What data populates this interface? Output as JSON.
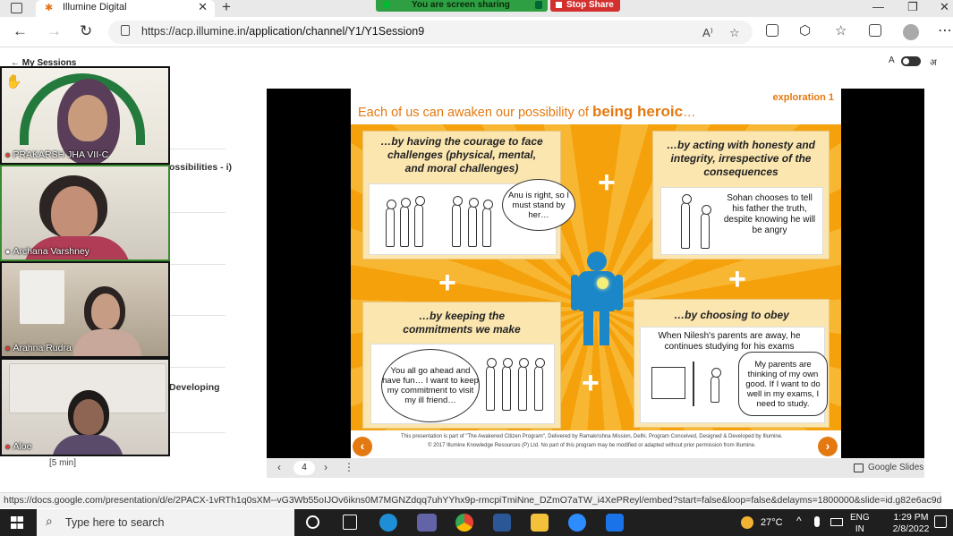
{
  "browser": {
    "tab_title": "Illumine Digital",
    "new_tab": "+",
    "tab_close": "✕",
    "url_host": "https://acp.illumine.in",
    "url_path": "/application/channel/Y1/Y1Session9",
    "status_url": "https://docs.google.com/presentation/d/e/2PACX-1vRTh1q0sXM--vG3Wb55oIJOv6ikns0M7MGNZdqq7uhYYhx9p-rmcpiTmiNne_DZmO7aTW_i4XePReyl/embed?start=false&loop=false&delayms=1800000&slide=id.g82e6ac9d00_2_2...",
    "window_controls": [
      "—",
      "❐",
      "✕"
    ]
  },
  "sharing": {
    "status": "You are screen sharing",
    "stop_label": "Stop Share"
  },
  "page": {
    "back_link": "← My Sessions",
    "lang_left": "A",
    "lang_right": "अ",
    "list_items": [
      "ossibilities - i)",
      "Developing"
    ],
    "duration": "[5 min]"
  },
  "participants": [
    {
      "name": "PRAKARSH JHA VII-C"
    },
    {
      "name": "Archana Varshney"
    },
    {
      "name": "Arahna Rudra"
    },
    {
      "name": "Aloe"
    }
  ],
  "slide": {
    "tag": "exploration 1",
    "title_prefix": "Each of us can awaken our possibility of",
    "title_emph": "being heroic",
    "title_suffix": "…",
    "panels": [
      {
        "heading": "…by having the courage to face challenges (physical, mental, and moral challenges)",
        "bubble": "Anu is right, so I must stand by her…"
      },
      {
        "heading": "…by acting with honesty and integrity, irrespective of the consequences",
        "caption": "Sohan chooses to tell his father the truth, despite knowing he will be angry"
      },
      {
        "heading": "…by keeping the commitments we make",
        "bubble": "You all go ahead and have fun… I want to keep my commitment to visit my ill friend…"
      },
      {
        "heading": "…by choosing to obey",
        "caption": "When Nilesh's parents are away, he continues studying for his exams",
        "bubble": "My parents are thinking of my own good. If I want to do well in my exams, I need to study."
      }
    ],
    "plus": "+",
    "footer_line1": "This presentation is part of \"The Awakened Citizen Program\", Delivered by Ramakrishna Mission, Delhi. Program Conceived, Designed & Developed by Illumine.",
    "footer_line2": "© 2017 Illumine Knowledge Resources (P) Ltd. No part of this program may be modified or adapted without prior permission from Illumine.",
    "nav_prev": "‹",
    "nav_next": "›"
  },
  "controls": {
    "prev": "‹",
    "page": "4",
    "next": "›",
    "menu": "⋮",
    "brand": "Google Slides"
  },
  "taskbar": {
    "search_placeholder": "Type here to search",
    "temperature": "27°C",
    "lang_line1": "ENG",
    "lang_line2": "IN",
    "time": "1:29 PM",
    "date": "2/8/2022",
    "colors": {
      "edge": "#1e8fd6",
      "teams": "#6264a7",
      "chrome": "#34a853",
      "word": "#2b5797",
      "explorer": "#f3c13a",
      "zoom": "#2d8cff",
      "misc": "#1a73e8"
    }
  }
}
